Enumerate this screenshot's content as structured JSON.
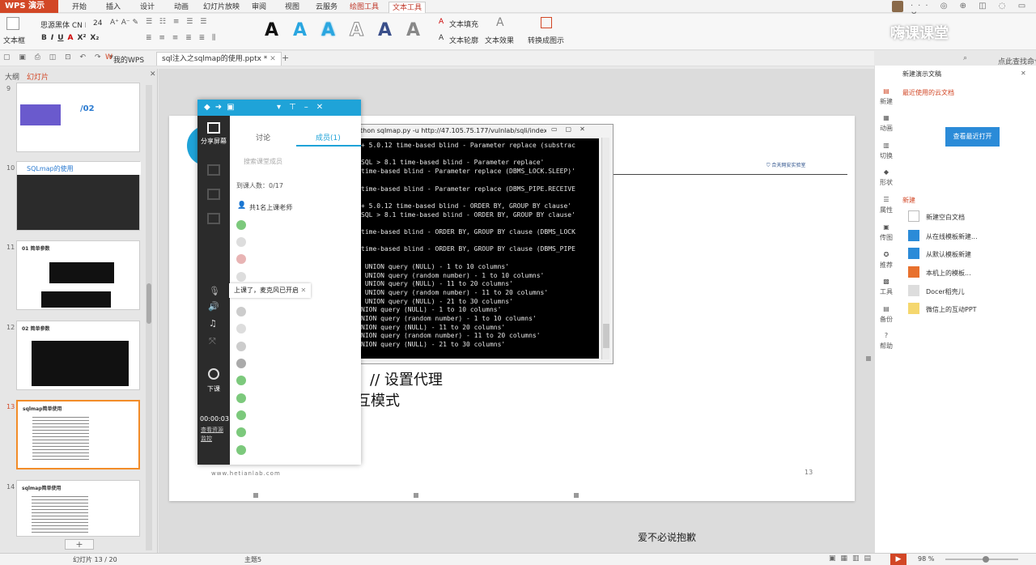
{
  "titlebar": {
    "app_name": "WPS 演示",
    "menus": [
      "开始",
      "插入",
      "设计",
      "动画",
      "幻灯片放映",
      "审阅",
      "视图",
      "云服务",
      "绘图工具",
      "文本工具"
    ]
  },
  "ribbon": {
    "textbox_label": "文本框",
    "font_name": "思源黑体 CN N",
    "font_size": "24",
    "text_fill": "文本填充",
    "text_outline": "文本轮廓",
    "text_effect": "文本效果",
    "convert_art": "转换成图示",
    "art_letter": "A"
  },
  "quickbar": {
    "my_wps": "我的WPS",
    "doc_tab": "sql注入之sqlmap的使用.pptx *",
    "add_tab": "+"
  },
  "leftpanel": {
    "tab_outline": "大纲",
    "tab_slides": "幻灯片",
    "slides": [
      {
        "num": "9",
        "title": "/02"
      },
      {
        "num": "10",
        "title": "SQLmap的使用"
      },
      {
        "num": "11",
        "title": "01 简单参数"
      },
      {
        "num": "12",
        "title": "02 简单参数"
      },
      {
        "num": "13",
        "title": "sqlmap简单使用"
      },
      {
        "num": "14",
        "title": "sqlmap简单使用"
      }
    ],
    "add_slide": "+"
  },
  "slide": {
    "text_line1": "// 设置代理",
    "text_line2": "互模式",
    "footer_url": "www.hetianlab.com",
    "page_num": "13"
  },
  "livepanel": {
    "tab_discuss": "讨论",
    "tab_members": "成员(1)",
    "search_placeholder": "搜索课堂成员",
    "online_count": "到课人数：0/17",
    "teacher_line": "共1名上课老师",
    "share_screen": "分享屏幕",
    "mic_notice": "上课了，麦克风已开启",
    "end_class": "下课",
    "timer": "00:00:03",
    "resource": "查看资源监控"
  },
  "terminal": {
    "title": "thon  sqlmap.py -u http://47.105.75.177/vulnlab/sqli/index...",
    "lines": [
      "+ 5.0.12 time-based blind - Parameter replace (substrac",
      "",
      "SQL > 8.1 time-based blind - Parameter replace'",
      "time-based blind - Parameter replace (DBMS_LOCK.SLEEP)'",
      "",
      "time-based blind - Parameter replace (DBMS_PIPE.RECEIVE",
      "",
      "+ 5.0.12 time-based blind - ORDER BY, GROUP BY clause'",
      "SQL > 8.1 time-based blind - ORDER BY, GROUP BY clause'",
      "",
      "time-based blind - ORDER BY, GROUP BY clause (DBMS_LOCK",
      "",
      "time-based blind - ORDER BY, GROUP BY clause (DBMS_PIPE",
      "",
      " UNION query (NULL) - 1 to 10 columns'",
      " UNION query (random number) - 1 to 10 columns'",
      " UNION query (NULL) - 11 to 20 columns'",
      " UNION query (random number) - 11 to 20 columns'",
      " UNION query (NULL) - 21 to 30 columns'",
      "NION query (NULL) - 1 to 10 columns'",
      "NION query (random number) - 1 to 10 columns'",
      "NION query (NULL) - 11 to 20 columns'",
      "NION query (random number) - 11 to 20 columns'",
      "NION query (NULL) - 21 to 30 columns'"
    ]
  },
  "rightpanel": {
    "new_doc": "新建演示文稿",
    "recent_cloud": "最近使用的云文档",
    "view_recent": "查看最近打开",
    "new_section": "新建",
    "items": [
      "新建空白文档",
      "从在线模板新建...",
      "从默认模板新建",
      "本机上的模板...",
      "Docer稻壳儿",
      "微信上的互动PPT"
    ],
    "side_icons": [
      "新建",
      "动画",
      "切换",
      "形状",
      "属性",
      "传图",
      "推荐",
      "工具",
      "备份",
      "帮助"
    ],
    "search_hint": "点此查找命令"
  },
  "statusbar": {
    "slide_pos": "幻灯片 13 / 20",
    "theme": "主题5",
    "zoom": "98 %"
  },
  "watermark": {
    "caption": "爱不必说抱歉",
    "brand": "嗨课课堂"
  },
  "colors": {
    "accent": "#d24726",
    "live_blue": "#1fa3d8",
    "tab_orange": "#f28c28"
  }
}
